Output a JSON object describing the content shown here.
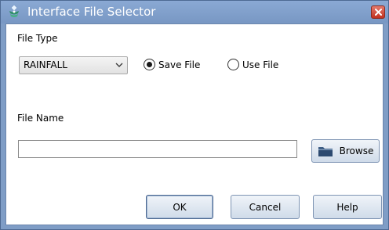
{
  "window": {
    "title": "Interface File Selector",
    "icon": "app-icon",
    "close_icon": "close-icon"
  },
  "file_type": {
    "label": "File Type",
    "selected": "RAINFALL",
    "options_visible": [
      "RAINFALL"
    ]
  },
  "mode": {
    "save_label": "Save File",
    "use_label": "Use File",
    "selected": "Save File"
  },
  "file_name": {
    "label": "File Name",
    "value": "",
    "placeholder": ""
  },
  "buttons": {
    "browse": "Browse",
    "ok": "OK",
    "cancel": "Cancel",
    "help": "Help"
  },
  "colors": {
    "titlebar": "#7f9dc6",
    "close": "#c2311f"
  }
}
